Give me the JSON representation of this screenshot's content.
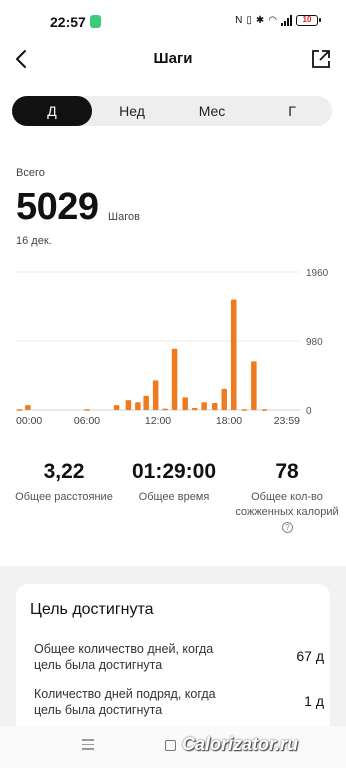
{
  "status_bar": {
    "time": "22:57",
    "battery": "10"
  },
  "header": {
    "title": "Шаги"
  },
  "tabs": [
    {
      "label": "Д",
      "active": true
    },
    {
      "label": "Нед",
      "active": false
    },
    {
      "label": "Мес",
      "active": false
    },
    {
      "label": "Г",
      "active": false
    }
  ],
  "summary": {
    "total_label": "Всего",
    "steps": "5029",
    "unit": "Шагов",
    "date": "16 дек."
  },
  "chart_data": {
    "type": "bar",
    "x_unit": "hour",
    "x": [
      0.3,
      1.0,
      6.0,
      8.5,
      9.5,
      10.3,
      11.0,
      11.8,
      12.6,
      13.4,
      14.3,
      15.1,
      15.9,
      16.8,
      17.6,
      18.4,
      19.3,
      20.1,
      21.0
    ],
    "values": [
      10,
      70,
      10,
      70,
      140,
      110,
      200,
      420,
      20,
      870,
      180,
      30,
      110,
      100,
      300,
      1570,
      10,
      690,
      10
    ],
    "x_ticks": [
      "00:00",
      "06:00",
      "12:00",
      "18:00",
      "23:59"
    ],
    "y_ticks": [
      "1960",
      "980",
      "0"
    ],
    "ylim": [
      0,
      1960
    ],
    "color": "#f07a1e"
  },
  "stats": [
    {
      "value": "3,22",
      "label": "Общее расстояние"
    },
    {
      "value": "01:29:00",
      "label": "Общее время"
    },
    {
      "value": "78",
      "label": "Общее кол-во сожженных калорий"
    }
  ],
  "goal": {
    "title": "Цель достигнута",
    "rows": [
      {
        "label": "Общее количество дней, когда цель была достигнута",
        "value": "67 д"
      },
      {
        "label": "Количество дней подряд, когда цель была достигнута",
        "value": "1 д"
      }
    ]
  },
  "watermark": "Calorizator.ru",
  "colors": {
    "accent": "#f07a1e",
    "active_tab": "#111111",
    "status_app": "#3ccb7a"
  },
  "icons": {
    "back": "chevron-left-icon",
    "share": "share-icon",
    "help": "question-icon"
  }
}
